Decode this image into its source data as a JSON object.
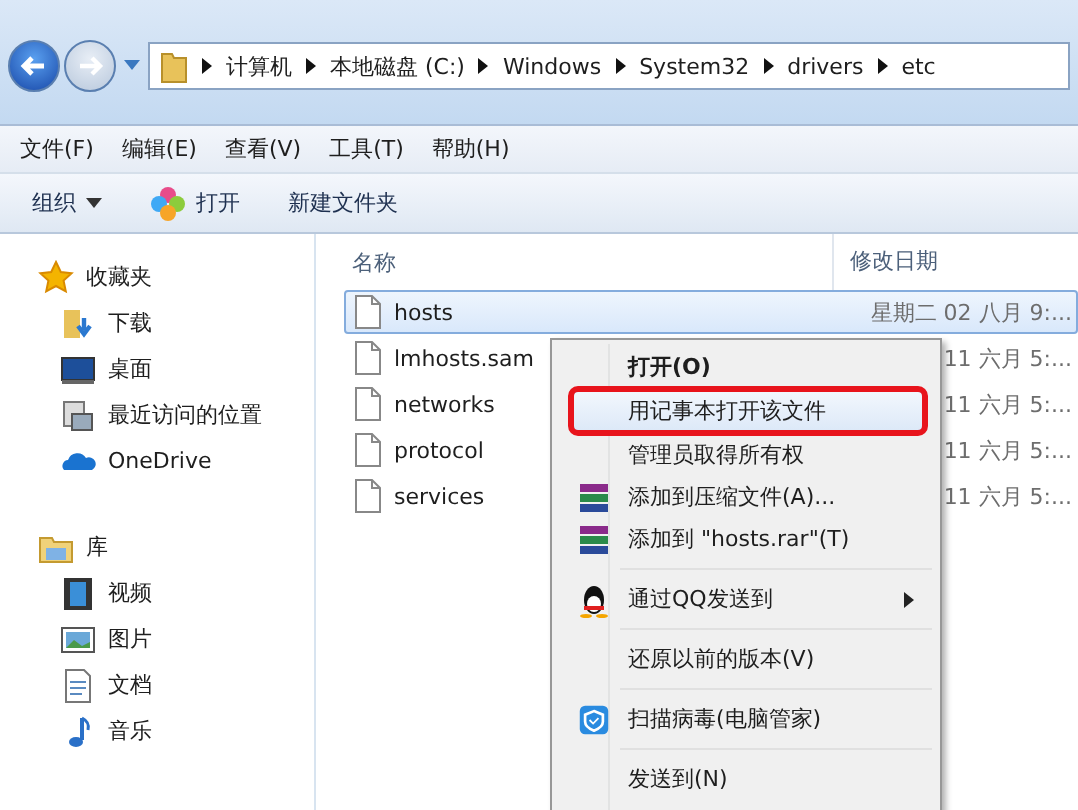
{
  "address_bar": {
    "crumbs": [
      "计算机",
      "本地磁盘 (C:)",
      "Windows",
      "System32",
      "drivers",
      "etc"
    ]
  },
  "menu_bar": [
    "文件(F)",
    "编辑(E)",
    "查看(V)",
    "工具(T)",
    "帮助(H)"
  ],
  "toolbar": {
    "organize": "组织",
    "open": "打开",
    "new_folder": "新建文件夹"
  },
  "sidebar": {
    "groups": [
      {
        "label": "收藏夹",
        "kind": "favorites",
        "items": [
          {
            "label": "下载",
            "kind": "download"
          },
          {
            "label": "桌面",
            "kind": "desktop"
          },
          {
            "label": "最近访问的位置",
            "kind": "recent"
          },
          {
            "label": "OneDrive",
            "kind": "cloud"
          }
        ]
      },
      {
        "label": "库",
        "kind": "library",
        "items": [
          {
            "label": "视频",
            "kind": "video"
          },
          {
            "label": "图片",
            "kind": "pictures"
          },
          {
            "label": "文档",
            "kind": "documents"
          },
          {
            "label": "音乐",
            "kind": "music"
          }
        ]
      }
    ]
  },
  "table": {
    "columns": [
      "名称",
      "修改日期"
    ],
    "rows": [
      {
        "name": "hosts",
        "date": "星期二 02 八月 9:...",
        "selected": true
      },
      {
        "name": "lmhosts.sam",
        "date": "11 六月 5:...",
        "selected": false
      },
      {
        "name": "networks",
        "date": "11 六月 5:...",
        "selected": false
      },
      {
        "name": "protocol",
        "date": "11 六月 5:...",
        "selected": false
      },
      {
        "name": "services",
        "date": "11 六月 5:...",
        "selected": false
      }
    ]
  },
  "context_menu": {
    "items": [
      {
        "kind": "plain",
        "label": "打开(O)",
        "bold": true,
        "selected": false
      },
      {
        "kind": "plain",
        "label": "用记事本打开该文件",
        "selected": true,
        "outlined": true
      },
      {
        "kind": "plain",
        "label": "管理员取得所有权",
        "selected": false
      },
      {
        "kind": "archive",
        "label": "添加到压缩文件(A)...",
        "selected": false
      },
      {
        "kind": "archive",
        "label": "添加到 \"hosts.rar\"(T)",
        "selected": false
      },
      {
        "kind": "separator"
      },
      {
        "kind": "penguin",
        "label": "通过QQ发送到",
        "submenu": true,
        "selected": false
      },
      {
        "kind": "separator"
      },
      {
        "kind": "plain",
        "label": "还原以前的版本(V)",
        "selected": false
      },
      {
        "kind": "separator"
      },
      {
        "kind": "shield",
        "label": "扫描病毒(电脑管家)",
        "selected": false
      },
      {
        "kind": "separator"
      },
      {
        "kind": "plain",
        "label": "发送到(N)",
        "selected": false
      }
    ]
  }
}
